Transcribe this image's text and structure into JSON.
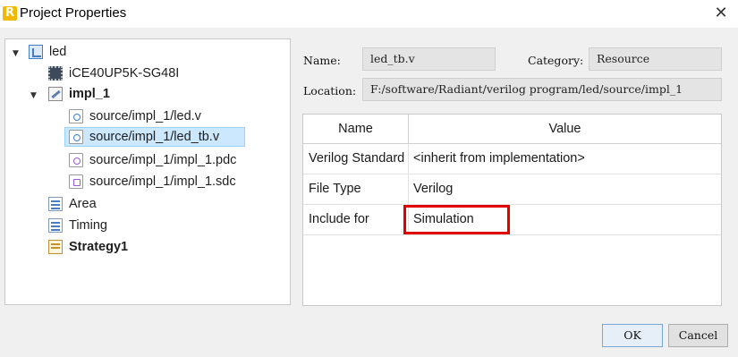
{
  "window": {
    "title": "Project Properties",
    "app_icon_letter": "R"
  },
  "tree": {
    "items": [
      {
        "label": "led",
        "icon": "project-icon",
        "bold": false,
        "expanded": true
      },
      {
        "label": "iCE40UP5K-SG48I",
        "icon": "chip-icon",
        "bold": false
      },
      {
        "label": "impl_1",
        "icon": "implementation-icon",
        "bold": true,
        "expanded": true
      },
      {
        "label": "source/impl_1/led.v",
        "icon": "verilog-file-icon",
        "bold": false
      },
      {
        "label": "source/impl_1/led_tb.v",
        "icon": "verilog-file-icon",
        "bold": false,
        "selected": true
      },
      {
        "label": "source/impl_1/impl_1.pdc",
        "icon": "constraint-file-icon",
        "bold": false
      },
      {
        "label": "source/impl_1/impl_1.sdc",
        "icon": "constraint-file-icon",
        "bold": false
      },
      {
        "label": "Area",
        "icon": "strategy-list-icon",
        "bold": false
      },
      {
        "label": "Timing",
        "icon": "strategy-list-icon",
        "bold": false
      },
      {
        "label": "Strategy1",
        "icon": "active-strategy-icon",
        "bold": true
      }
    ]
  },
  "form": {
    "name_label": "Name:",
    "name_value": "led_tb.v",
    "category_label": "Category:",
    "category_value": "Resource",
    "location_label": "Location:",
    "location_value": "F:/software/Radiant/verilog program/led/source/impl_1"
  },
  "properties": {
    "columns": [
      "Name",
      "Value"
    ],
    "rows": [
      {
        "name": "Verilog Standard",
        "value": "<inherit from implementation>"
      },
      {
        "name": "File Type",
        "value": "Verilog"
      },
      {
        "name": "Include for",
        "value": "Simulation",
        "highlighted": true
      }
    ]
  },
  "buttons": {
    "ok": "OK",
    "cancel": "Cancel"
  },
  "colors": {
    "highlight_border": "#e00000",
    "selection_bg": "#cce8ff"
  }
}
